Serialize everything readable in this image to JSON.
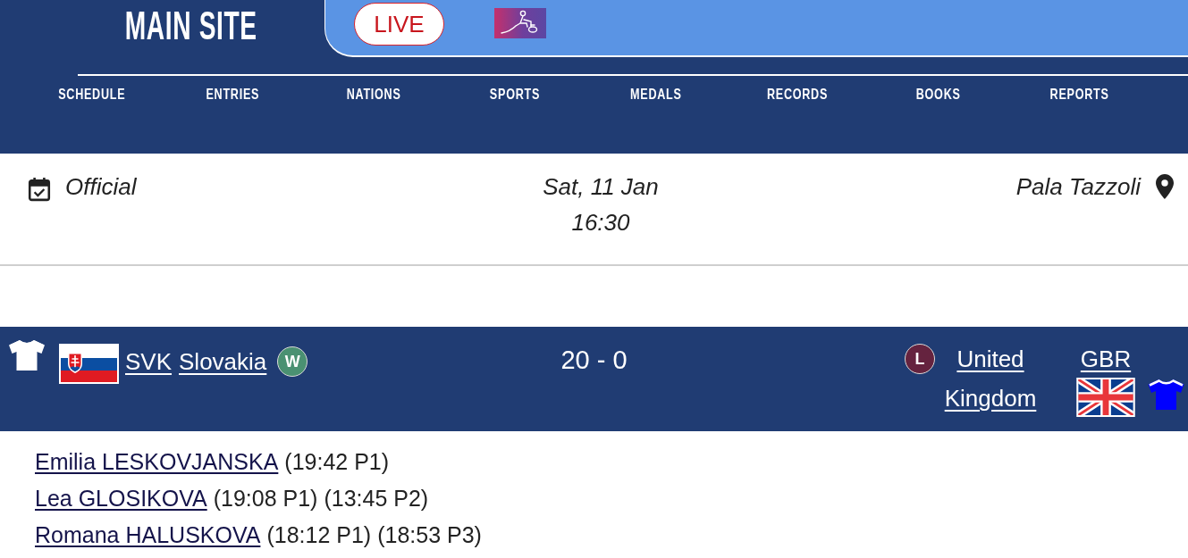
{
  "header": {
    "logo": "MAIN SITE",
    "live_button": "LIVE"
  },
  "nav": [
    "SCHEDULE",
    "ENTRIES",
    "NATIONS",
    "SPORTS",
    "MEDALS",
    "RECORDS",
    "BOOKS",
    "REPORTS"
  ],
  "event": {
    "status": "Official",
    "date": "Sat, 11 Jan",
    "time": "16:30",
    "venue": "Pala Tazzoli"
  },
  "match": {
    "score": "20 - 0",
    "teams": [
      {
        "kind": "home",
        "code": "SVK",
        "name": "Slovakia",
        "result": {
          "label": "W",
          "color": "#4a9172"
        },
        "flag": {
          "kind": "svk"
        },
        "shirt": {
          "color": "#ffffff"
        }
      },
      {
        "kind": "away",
        "code": "GBR",
        "name": "United Kingdom",
        "result": {
          "label": "L",
          "color": "#65233f"
        },
        "flag": {
          "kind": "gbr"
        },
        "shirt": {
          "color": "#0000ff"
        }
      }
    ]
  },
  "players": [
    {
      "name": "Emilia LESKOVJANSKA",
      "goals": [
        "(19:42 P1)"
      ]
    },
    {
      "name": "Lea GLOSIKOVA",
      "goals": [
        "(19:08 P1)",
        "(13:45 P2)"
      ]
    },
    {
      "name": "Romana HALUSKOVA",
      "goals": [
        "(18:12 P1)",
        "(18:53 P3)"
      ]
    }
  ]
}
